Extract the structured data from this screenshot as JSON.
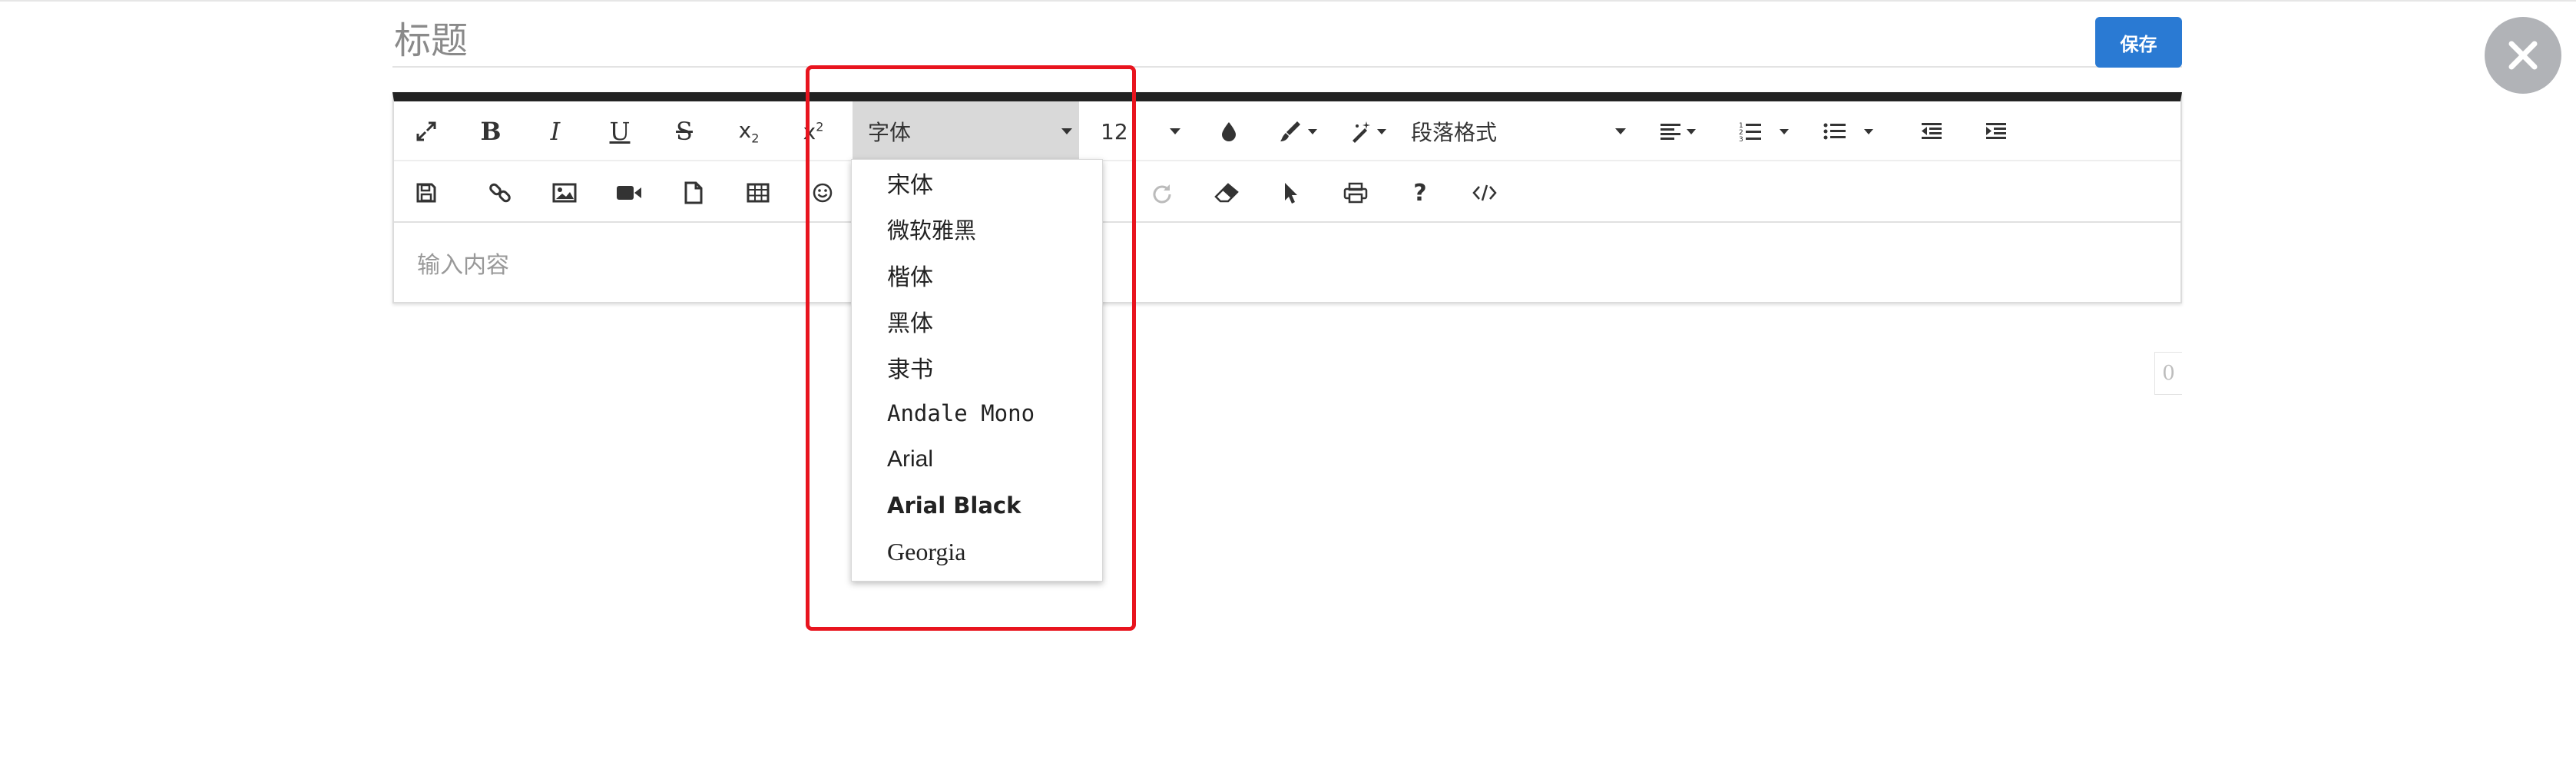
{
  "page": {
    "title_placeholder": "标题",
    "save_label": "保存",
    "accent_color": "#2a7ad3",
    "highlight_color": "#e8141e"
  },
  "toolbar": {
    "font_family_label": "字体",
    "font_size_value": "12",
    "paragraph_format_label": "段落格式",
    "row1_icons": [
      "fullscreen-icon",
      "bold-icon",
      "italic-icon",
      "underline-icon",
      "strikethrough-icon",
      "subscript-icon",
      "superscript-icon",
      "text-color-icon",
      "highlight-color-icon",
      "magic-icon",
      "align-icon",
      "ordered-list-icon",
      "unordered-list-icon",
      "outdent-icon",
      "indent-icon"
    ],
    "row2_icons": [
      "save-icon",
      "link-icon",
      "image-icon",
      "video-icon",
      "file-icon",
      "table-icon",
      "emoji-icon",
      "redo-icon",
      "eraser-icon",
      "select-icon",
      "print-icon",
      "help-icon",
      "code-view-icon"
    ]
  },
  "editor": {
    "content_placeholder": "输入内容",
    "word_count": "0"
  },
  "font_dropdown": {
    "items": [
      "宋体",
      "微软雅黑",
      "楷体",
      "黑体",
      "隶书",
      "Andale Mono",
      "Arial",
      "Arial Black",
      "Georgia"
    ]
  }
}
